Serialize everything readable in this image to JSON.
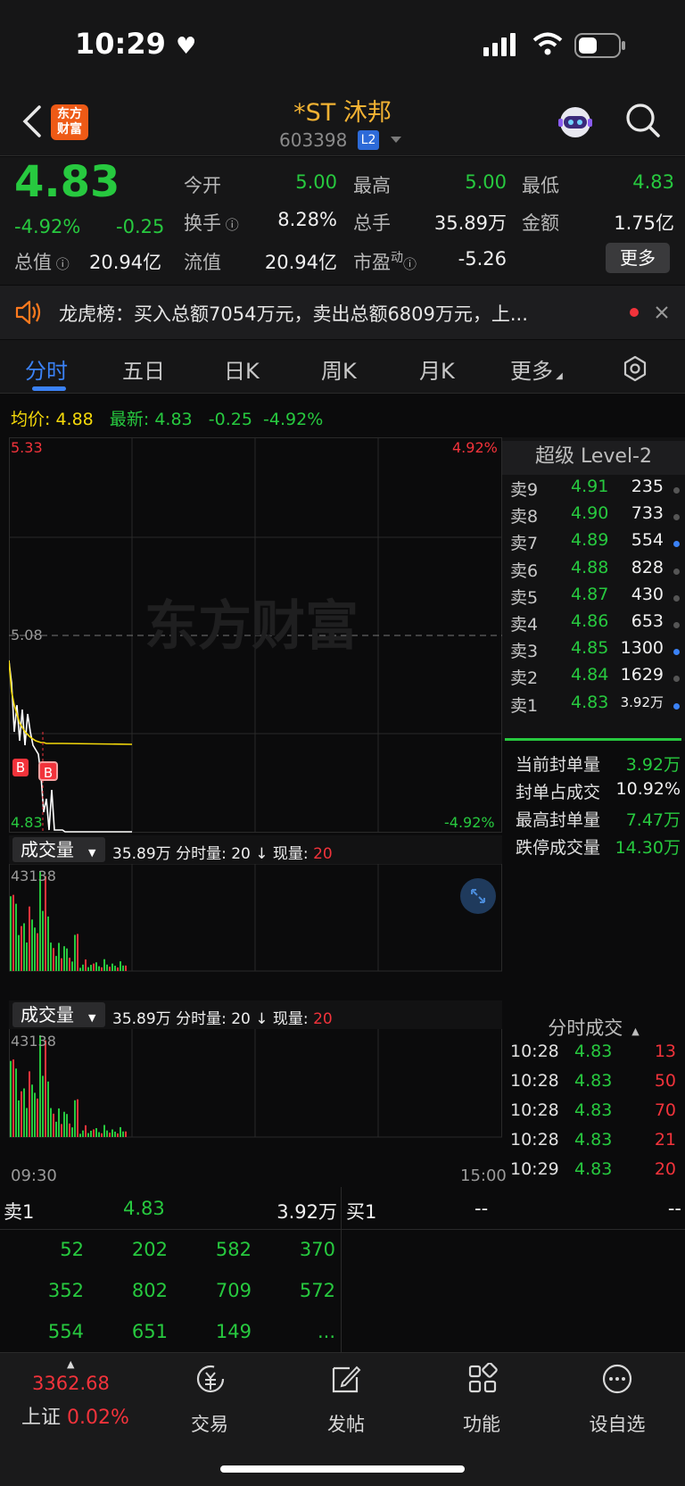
{
  "status_bar": {
    "time": "10:29"
  },
  "header": {
    "logo_line1": "东方",
    "logo_line2": "财富",
    "stock_name": "*ST 沐邦",
    "stock_code": "603398",
    "level_badge": "L2"
  },
  "quote": {
    "price": "4.83",
    "change_pct": "-4.92%",
    "change": "-0.25",
    "fields": {
      "open_label": "今开",
      "open": "5.00",
      "high_label": "最高",
      "high": "5.00",
      "low_label": "最低",
      "low": "4.83",
      "turnover_label": "换手",
      "turnover": "8.28%",
      "volume_label": "总手",
      "volume": "35.89万",
      "amount_label": "金额",
      "amount": "1.75亿",
      "mktcap_label": "总值",
      "mktcap": "20.94亿",
      "float_label": "流值",
      "float": "20.94亿",
      "pe_label": "市盈",
      "pe_sup": "动",
      "pe": "-5.26"
    },
    "more_label": "更多"
  },
  "notice": {
    "text": "龙虎榜：买入总额7054万元，卖出总额6809万元，上..."
  },
  "tabs": [
    "分时",
    "五日",
    "日K",
    "周K",
    "月K",
    "更多"
  ],
  "avg_row": {
    "avg_label": "均价:",
    "avg_value": "4.88",
    "latest_label": "最新:",
    "latest_value": "4.83",
    "latest_change": "-0.25",
    "latest_pct": "-4.92%"
  },
  "chart_labels": {
    "top_price": "5.33",
    "top_pct": "4.92%",
    "mid_price": "5.08",
    "bottom_price": "4.83",
    "bottom_pct": "-4.92%",
    "watermark": "东方财富",
    "vol_max_1": "43138",
    "vol_max_2": "43138",
    "time_start": "09:30",
    "time_end": "15:00",
    "marker_b": "B"
  },
  "volume_bar": {
    "dropdown": "成交量",
    "total": "35.89万",
    "minute_label": "分时量:",
    "minute_value": "20",
    "arrow": "↓",
    "current_label": "现量:",
    "current_value": "20"
  },
  "level2": {
    "title": "超级 Level-2",
    "asks": [
      {
        "label": "卖9",
        "price": "4.91",
        "qty": "235",
        "dot": "gray"
      },
      {
        "label": "卖8",
        "price": "4.90",
        "qty": "733",
        "dot": "gray"
      },
      {
        "label": "卖7",
        "price": "4.89",
        "qty": "554",
        "dot": "blue"
      },
      {
        "label": "卖6",
        "price": "4.88",
        "qty": "828",
        "dot": "gray"
      },
      {
        "label": "卖5",
        "price": "4.87",
        "qty": "430",
        "dot": "gray"
      },
      {
        "label": "卖4",
        "price": "4.86",
        "qty": "653",
        "dot": "gray"
      },
      {
        "label": "卖3",
        "price": "4.85",
        "qty": "1300",
        "dot": "blue"
      },
      {
        "label": "卖2",
        "price": "4.84",
        "qty": "1629",
        "dot": "gray"
      },
      {
        "label": "卖1",
        "price": "4.83",
        "qty": "3.92万",
        "dot": "blue"
      }
    ],
    "seal": [
      {
        "label": "当前封单量",
        "value": "3.92万"
      },
      {
        "label": "封单占成交",
        "value": "10.92%"
      },
      {
        "label": "最高封单量",
        "value": "7.47万"
      },
      {
        "label": "跌停成交量",
        "value": "14.30万"
      }
    ]
  },
  "ticks": {
    "title": "分时成交",
    "rows": [
      {
        "time": "10:28",
        "price": "4.83",
        "vol": "13"
      },
      {
        "time": "10:28",
        "price": "4.83",
        "vol": "50"
      },
      {
        "time": "10:28",
        "price": "4.83",
        "vol": "70"
      },
      {
        "time": "10:28",
        "price": "4.83",
        "vol": "21"
      },
      {
        "time": "10:29",
        "price": "4.83",
        "vol": "20"
      }
    ]
  },
  "queue": {
    "sell_label": "卖1",
    "sell_price": "4.83",
    "sell_qty": "3.92万",
    "buy_label": "买1",
    "buy_price": "--",
    "buy_qty": "--",
    "rows": [
      [
        "52",
        "202",
        "582",
        "370"
      ],
      [
        "352",
        "802",
        "709",
        "572"
      ],
      [
        "554",
        "651",
        "149",
        "..."
      ]
    ]
  },
  "bottom_nav": {
    "index_value": "3362.68",
    "index_name": "上证",
    "index_pct": "0.02%",
    "items": [
      "交易",
      "发帖",
      "功能",
      "设自选"
    ]
  },
  "colors": {
    "up": "#f2333b",
    "down": "#27c93f",
    "avg": "#f5d90a",
    "accent": "#3b82f6",
    "title": "#f2b233"
  }
}
